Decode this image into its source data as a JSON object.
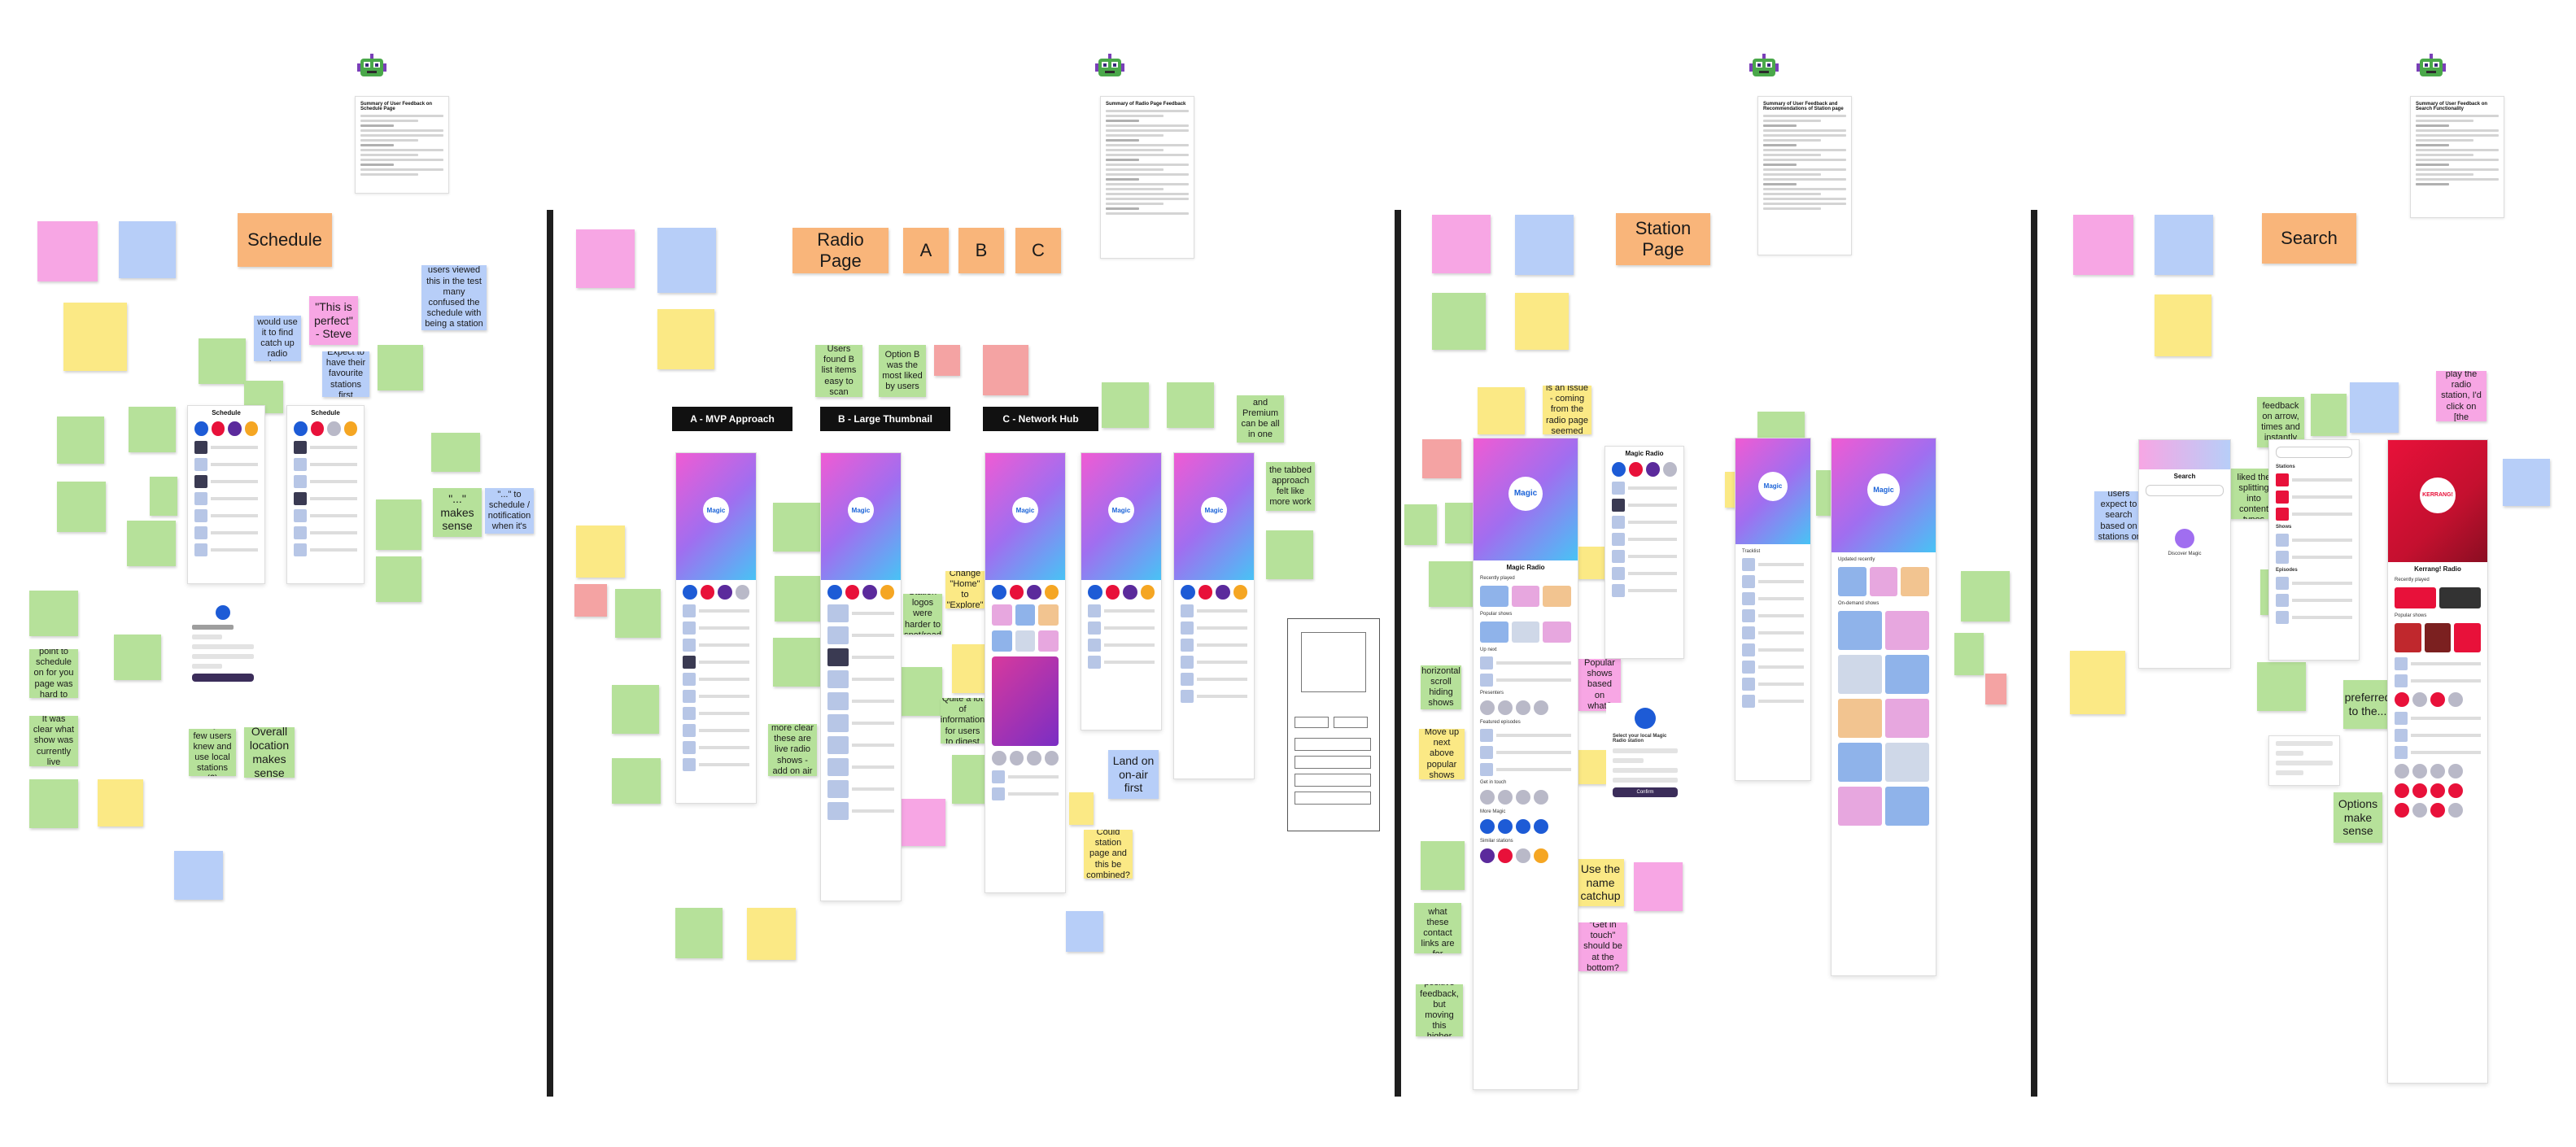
{
  "sections": {
    "schedule": {
      "title": "Schedule",
      "report_title": "Summary of User Feedback on Schedule Page",
      "notes": {
        "quote": "\"This is perfect\" - Steve",
        "catchup": "Some would use it to find catch up radio shows",
        "favourites": "Expect to have their favourite stations first",
        "confused": "In the prism users viewed this in the test many confused the schedule with being a station home page",
        "makes_sense": "\"...\" makes sense",
        "notification": "Expect \"...\" to schedule / notification when it's on",
        "few_users": "Only a few users knew and use local stations (?)",
        "location": "Overall location makes sense",
        "simple": "It was clear what show was currently live",
        "entry_point": "Entry point to schedule on for you page was hard to find"
      }
    },
    "radio_page": {
      "title": "Radio Page",
      "options": [
        "A",
        "B",
        "C"
      ],
      "report_title": "Summary of Radio Page Feedback",
      "tabs": [
        "A - MVP Approach",
        "B - Large Thumbnail",
        "C - Network Hub"
      ],
      "notes": {
        "users_found": "Users found B list items easy to scan",
        "option_b": "Option B was the most liked by users",
        "on_air": "On Air and Premium can be all in one page",
        "tabbed": "the tabbed approach felt like more work",
        "land": "Land on on-air first",
        "station_logos": "Station logos were harder to spot/read",
        "change_home": "Change \"Home\" to \"Explore\"",
        "lot_info": "Quite a lot of information for users to digest",
        "could_combine": "Could station page and this be combined?",
        "clear_shows": "Make more clear these are live radio shows - add on air tag?"
      }
    },
    "station_page": {
      "title": "Station Page",
      "report_title": "Summary of User Feedback and Recommendations of Station page",
      "app_name": "Magic Radio",
      "logo_text": "Magic",
      "notes": {
        "navigation": "Navigation is an issue - coming from the radio page seemed confused",
        "popular": "Popular shows based on what?",
        "catchup": "Use the name catchup",
        "get_in_touch": "\"Get in touch\" should be at the bottom?",
        "move_up": "Move up next above popular shows",
        "positive": "positive feedback, but moving this higher",
        "not_clear": "Not clear what these contact links are for",
        "horizontal": "horizontal scroll hiding shows"
      },
      "labels": {
        "recently_played": "Recently played",
        "popular_shows": "Popular shows",
        "up_next": "Up next",
        "presenters": "Presenters",
        "featured_episodes": "Featured episodes",
        "get_in_touch": "Get in touch",
        "more_magic": "More Magic",
        "similar_stations": "Similar stations",
        "tracklist": "Tracklist",
        "updated_recently": "Updated recently",
        "on_demand": "On-demand shows",
        "select_station": "Select your local Magic Radio station",
        "confirm": "Confirm"
      }
    },
    "search": {
      "title": "Search",
      "report_title": "Summary of User Feedback on Search Functionality",
      "app_name": "Kerrang! Radio",
      "notes": {
        "splitting": "Users liked the splitting into content types",
        "preferred": "preferred to the...",
        "options": "Options make sense",
        "mixed": "Mixed feedback on arrow, times and instantly play",
        "expect_search": "Some users expect to search based on stations or presenters",
        "wanted_play": "\"If I wanted to play the radio station, I'd click on [the station]\" - Ally"
      },
      "labels": {
        "search_placeholder": "Search",
        "discover": "Discover Magic",
        "stations": "Stations",
        "shows": "Shows",
        "episodes": "Episodes",
        "recently_played": "Recently played",
        "popular_shows": "Popular shows"
      }
    }
  },
  "colors": {
    "sticky_green": "#b6e19a",
    "sticky_pink": "#f7a6e4",
    "sticky_blue": "#b7cef8",
    "sticky_yellow": "#fbe985",
    "sticky_orange": "#f9b57a",
    "magic_gradient": "#a06ef0",
    "kerrang_red": "#e8113a"
  }
}
